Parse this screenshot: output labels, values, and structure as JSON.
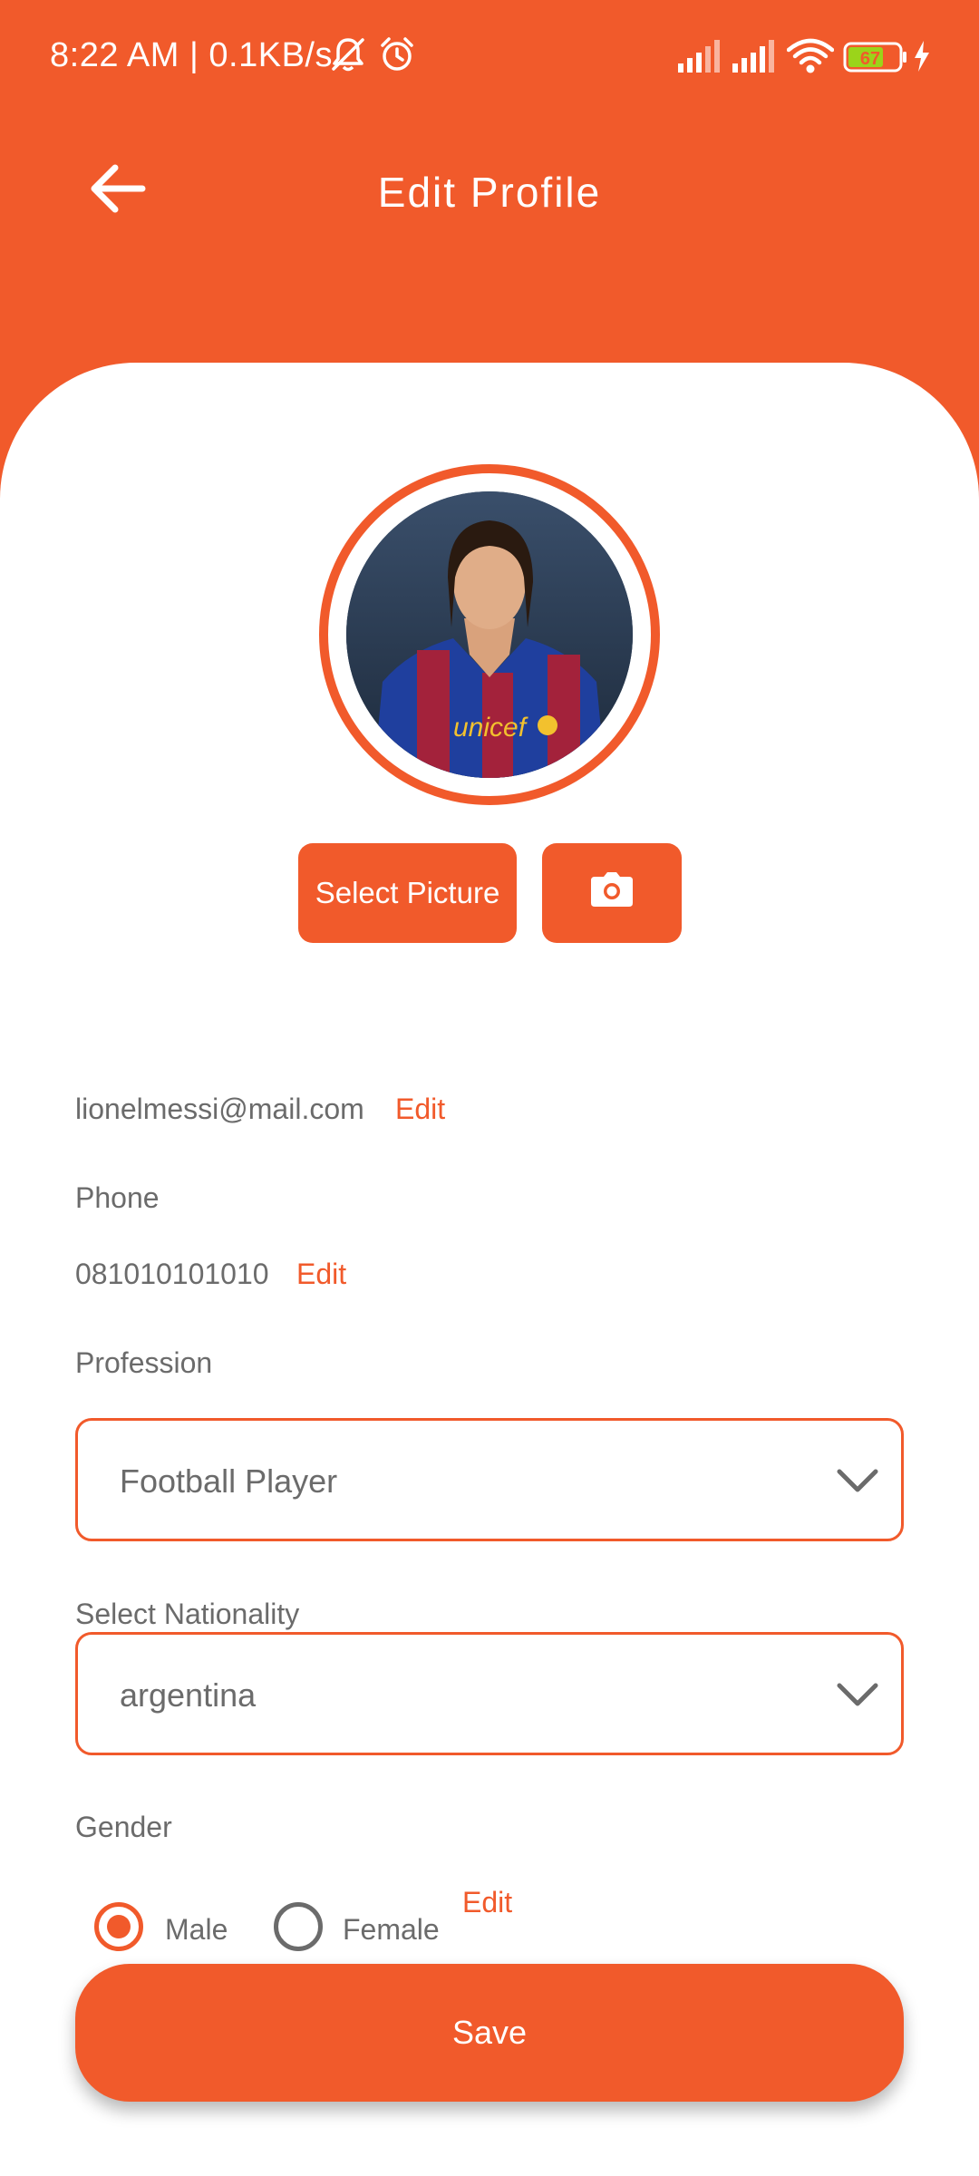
{
  "status_bar": {
    "time_speed": "8:22 AM | 0.1KB/s",
    "battery_level": "67",
    "icons": [
      "mute-bell-icon",
      "alarm-icon",
      "signal-icon",
      "signal-icon",
      "wifi-icon",
      "battery-icon",
      "charging-icon"
    ]
  },
  "header": {
    "title": "Edit Profile",
    "back_icon": "arrow-left-icon"
  },
  "profile": {
    "select_picture_label": "Select Picture",
    "camera_icon": "camera-icon"
  },
  "email": {
    "value": "lionelmessi@mail.com",
    "edit_label": "Edit"
  },
  "phone": {
    "label": "Phone",
    "value": "081010101010",
    "edit_label": "Edit"
  },
  "profession": {
    "label": "Profession",
    "selected": "Football Player"
  },
  "nationality": {
    "label": "Select Nationality",
    "selected": "argentina"
  },
  "gender": {
    "label": "Gender",
    "options": [
      {
        "label": "Male",
        "selected": true
      },
      {
        "label": "Female",
        "selected": false
      }
    ],
    "edit_label": "Edit"
  },
  "save_label": "Save",
  "colors": {
    "accent": "#F15A2B",
    "text_gray": "#6b6b6b",
    "card": "#FFFFFF"
  }
}
